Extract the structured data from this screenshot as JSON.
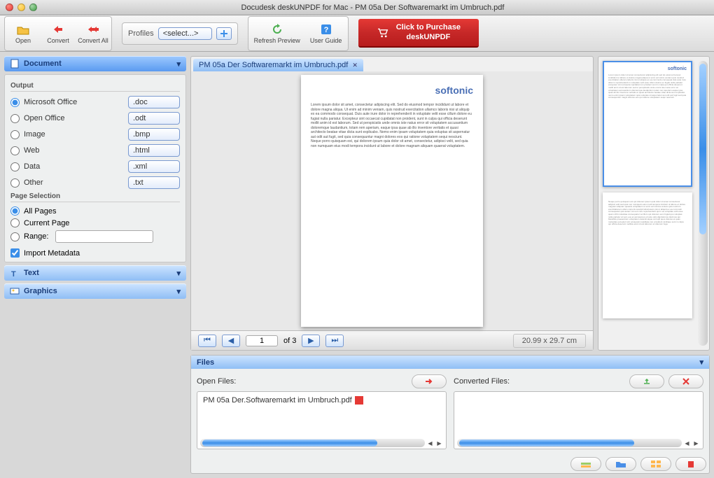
{
  "window": {
    "title": "Docudesk deskUNPDF for Mac - PM 05a Der Softwaremarkt im Umbruch.pdf"
  },
  "toolbar": {
    "open": "Open",
    "convert": "Convert",
    "convert_all": "Convert All",
    "profiles_label": "Profiles",
    "profiles_value": "<select...>",
    "refresh": "Refresh Preview",
    "user_guide": "User Guide",
    "purchase_line1": "Click to Purchase",
    "purchase_line2": "deskUNPDF"
  },
  "panels": {
    "document": "Document",
    "text": "Text",
    "graphics": "Graphics"
  },
  "output": {
    "section_label": "Output",
    "options": [
      {
        "label": "Microsoft Office",
        "ext": ".doc",
        "selected": true
      },
      {
        "label": "Open Office",
        "ext": ".odt",
        "selected": false
      },
      {
        "label": "Image",
        "ext": ".bmp",
        "selected": false
      },
      {
        "label": "Web",
        "ext": ".html",
        "selected": false
      },
      {
        "label": "Data",
        "ext": ".xml",
        "selected": false
      },
      {
        "label": "Other",
        "ext": ".txt",
        "selected": false
      }
    ]
  },
  "page_selection": {
    "section_label": "Page Selection",
    "all_pages": "All Pages",
    "current_page": "Current Page",
    "range": "Range:",
    "range_value": ""
  },
  "import_metadata": "Import Metadata",
  "preview": {
    "tab_title": "PM 05a Der Softwaremarkt im Umbruch.pdf",
    "logo_text": "softonic",
    "current_page": "1",
    "total_pages_label": "of 3",
    "dimensions": "20.99 x 29.7 cm"
  },
  "files": {
    "panel_title": "Files",
    "open_label": "Open Files:",
    "converted_label": "Converted Files:",
    "open_items": [
      "PM 05a Der.Softwaremarkt im Umbruch.pdf"
    ]
  }
}
